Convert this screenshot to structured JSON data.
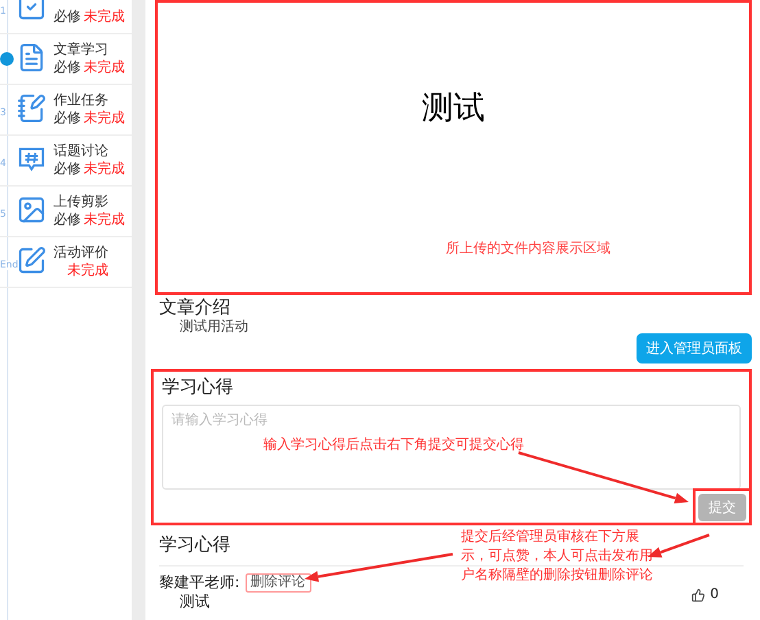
{
  "sidebar": {
    "steps": [
      {
        "number": "1",
        "kind": "checklist",
        "required": "必修",
        "status": "未完成",
        "selected": false
      },
      {
        "kind": "article",
        "title": "文章学习",
        "required": "必修",
        "status": "未完成",
        "selected": true
      },
      {
        "number": "3",
        "kind": "task",
        "title": "作业任务",
        "required": "必修",
        "status": "未完成",
        "selected": false
      },
      {
        "number": "4",
        "kind": "topic",
        "title": "话题讨论",
        "required": "必修",
        "status": "未完成",
        "selected": false
      },
      {
        "number": "5",
        "kind": "photo",
        "title": "上传剪影",
        "required": "必修",
        "status": "未完成",
        "selected": false
      },
      {
        "number": "End",
        "kind": "review",
        "title": "活动评价",
        "status": "未完成",
        "selected": false
      }
    ]
  },
  "preview": {
    "content_title": "测试",
    "annotation": "所上传的文件内容展示区域"
  },
  "article_intro": {
    "heading": "文章介绍",
    "text": "测试用活动"
  },
  "admin_button": "进入管理员面板",
  "reflection_form": {
    "heading": "学习心得",
    "placeholder": "请输入学习心得",
    "annotation": "输入学习心得后点击右下角提交可提交心得",
    "submit_button": {
      "label": "提交",
      "disabled": true
    }
  },
  "reflections": {
    "heading": "学习心得",
    "annotation": "提交后经管理员审核在下方展示，可点赞，本人可点击发布用户名称隔壁的删除按钮删除评论",
    "comments": [
      {
        "author": "黎建平老师:",
        "delete_button": "删除评论",
        "text": "测试",
        "likes": "0"
      }
    ]
  }
}
